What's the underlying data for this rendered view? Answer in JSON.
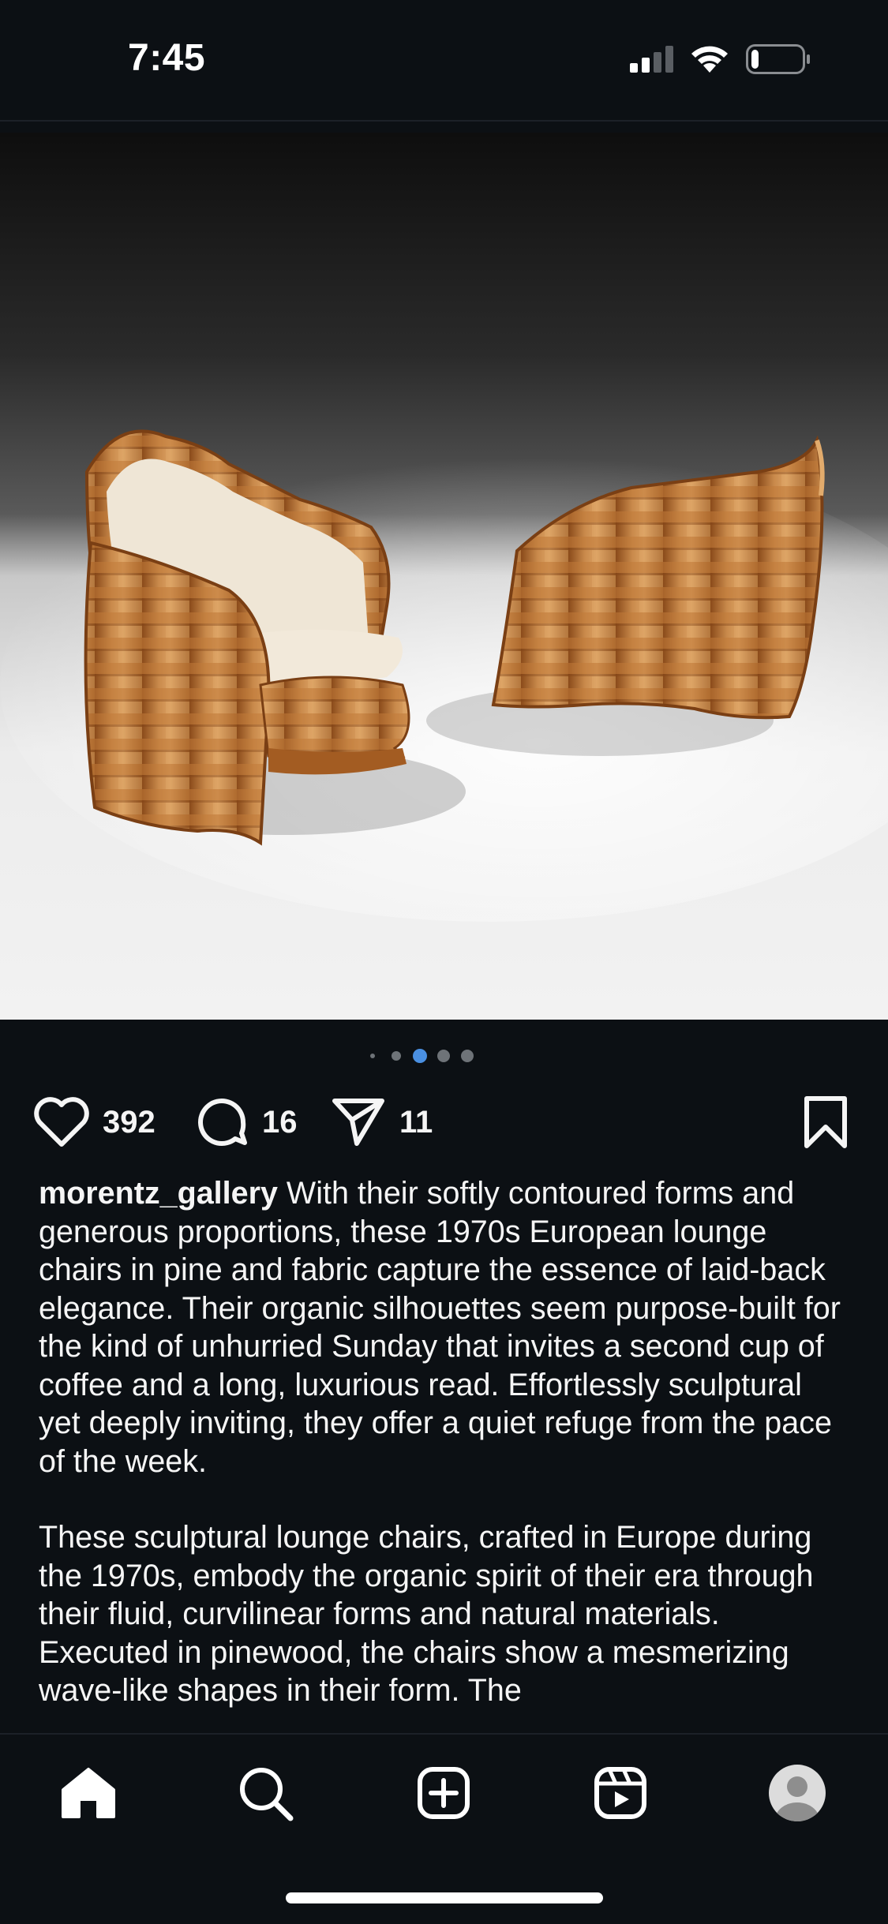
{
  "status_bar": {
    "time": "7:45",
    "signal_icon": "cellular-signal-icon",
    "wifi_icon": "wifi-icon",
    "battery_icon": "battery-low-icon",
    "battery_level": 0.15
  },
  "post": {
    "image_alt": "Two sculptural pine lounge chairs, one with cream cushions",
    "carousel": {
      "total_dots": 5,
      "active_index": 2,
      "active_color": "#4a90e2"
    },
    "actions": {
      "like_icon": "heart-icon",
      "likes": "392",
      "comment_icon": "comment-icon",
      "comments": "16",
      "share_icon": "send-icon",
      "shares": "11",
      "save_icon": "bookmark-icon"
    },
    "caption": {
      "username": "morentz_gallery",
      "text": " With their softly contoured forms and generous proportions, these 1970s European lounge chairs in pine and fabric capture the essence of laid-back elegance. Their organic silhouettes seem purpose-built for the kind of unhurried Sunday that invites a second cup of coffee and a long, luxurious read. Effortlessly sculptural yet deeply inviting, they offer a quiet refuge from the pace of the week.",
      "paragraph2": "These sculptural lounge chairs, crafted in Europe during the 1970s, embody the organic spirit of their era through their fluid, curvilinear forms and natural materials. Executed in pinewood, the chairs show a mesmerizing wave-like shapes in their form. The"
    }
  },
  "tab_bar": {
    "items": [
      {
        "name": "home",
        "icon": "home-icon",
        "active": true
      },
      {
        "name": "search",
        "icon": "search-icon"
      },
      {
        "name": "create",
        "icon": "add-square-icon"
      },
      {
        "name": "reels",
        "icon": "reels-icon"
      },
      {
        "name": "profile",
        "icon": "profile-avatar-icon"
      }
    ]
  },
  "colors": {
    "background": "#0c1014",
    "text": "#f5f5f5",
    "accent": "#4a90e2"
  }
}
